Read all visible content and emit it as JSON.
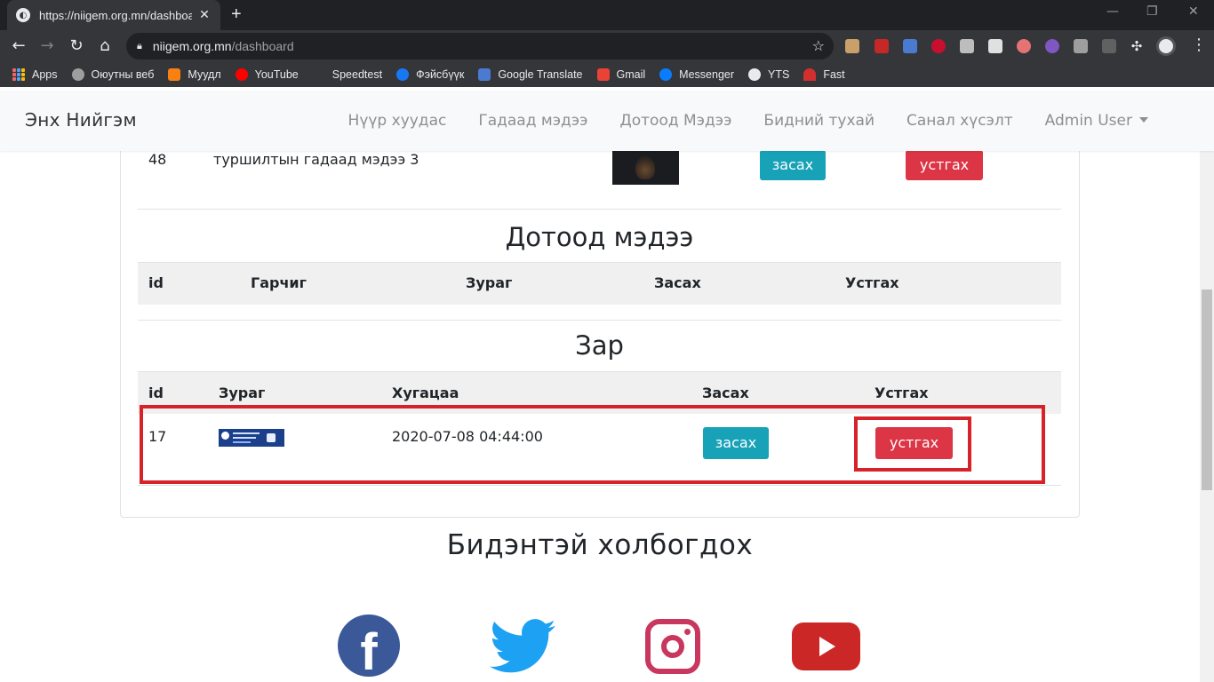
{
  "browser": {
    "tab_title": "https://niigem.org.mn/dashboard",
    "address_host": "niigem.org.mn",
    "address_path": "/dashboard",
    "bookmarks": [
      "Apps",
      "Оюутны веб",
      "Муудл",
      "YouTube",
      "Speedtest",
      "Фэйсбүүк",
      "Google Translate",
      "Gmail",
      "Messenger",
      "YTS",
      "Fast"
    ]
  },
  "navbar": {
    "brand": "Энх Нийгэм",
    "links": [
      "Нүүр хуудас",
      "Гадаад мэдээ",
      "Дотоод Мэдээ",
      "Бидний тухай",
      "Санал хүсэлт"
    ],
    "user": "Admin User"
  },
  "foreign_news": {
    "row": {
      "id": "48",
      "title": "туршилтын гадаад мэдээ 3",
      "edit_label": "засах",
      "delete_label": "устгах"
    }
  },
  "domestic_news": {
    "heading": "Дотоод мэдээ",
    "columns": [
      "id",
      "Гарчиг",
      "Зураг",
      "Засах",
      "Устгах"
    ]
  },
  "ads": {
    "heading": "Зар",
    "columns": [
      "id",
      "Зураг",
      "Хугацаа",
      "Засах",
      "Устгах"
    ],
    "row": {
      "id": "17",
      "expires": "2020-07-08 04:44:00",
      "edit_label": "засах",
      "delete_label": "устгах"
    }
  },
  "footer": {
    "heading": "Бидэнтэй холбогдох",
    "social": [
      "facebook",
      "twitter",
      "instagram",
      "youtube"
    ]
  },
  "colors": {
    "info": "#17a2b8",
    "danger": "#dc3545",
    "highlight": "#d7222a"
  }
}
